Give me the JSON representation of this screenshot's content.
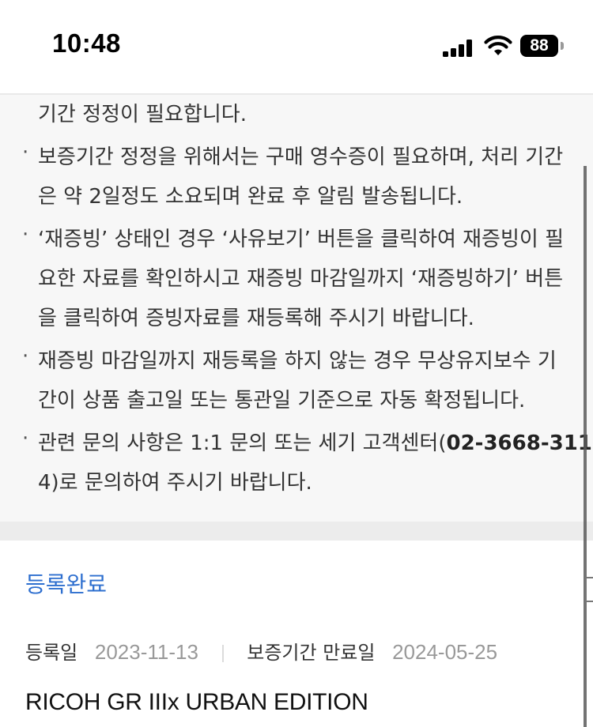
{
  "status_bar": {
    "time": "10:48",
    "battery": "88"
  },
  "notice": {
    "lines": [
      "기간 정정이 필요합니다.",
      "보증기간 정정을 위해서는 구매 영수증이 필요하며, 처리 기간",
      "은 약 2일정도 소요되며 완료 후 알림 발송됩니다.",
      "‘재증빙’ 상태인 경우 ‘사유보기’ 버튼을 클릭하여 재증빙이 필",
      "요한 자료를 확인하시고 재증빙 마감일까지 ‘재증빙하기’ 버튼",
      "을 클릭하여 증빙자료를 재등록해 주시기 바랍니다.",
      "재증빙 마감일까지 재등록을 하지 않는 경우 무상유지보수 기",
      "간이 상품 출고일 또는 통관일 기준으로 자동 확정됩니다.",
      "관련 문의 사항은 1:1 문의 또는 세기 고객센터(",
      "4)로 문의하여 주시기 바랍니다."
    ],
    "phone_part1": "02-3668-311",
    "bullet": "·"
  },
  "registration": {
    "status": "등록완료",
    "registered_label": "등록일",
    "registered_date": "2023-11-13",
    "warranty_label": "보증기간 만료일",
    "warranty_date": "2024-05-25",
    "product_name": "RICOH GR IIIx URBAN EDITION"
  }
}
